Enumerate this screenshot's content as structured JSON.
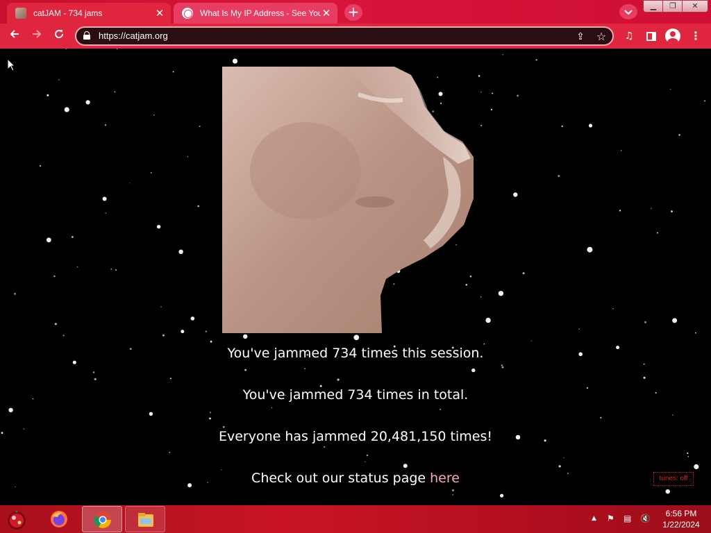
{
  "browser": {
    "tabs": [
      {
        "title": "catJAM - 734 jams",
        "active": true,
        "favicon": "cat-favicon-icon"
      },
      {
        "title": "What Is My IP Address - See Your",
        "active": false,
        "favicon": "globe-icon"
      }
    ],
    "new_tab_symbol": "+",
    "address": {
      "url": "https://catjam.org"
    },
    "theme_color": "#e0263f"
  },
  "page": {
    "session_message": "You've jammed 734 times this session.",
    "total_message": "You've jammed 734 times in total.",
    "global_message": "Everyone has jammed 20,481,150 times!",
    "status_prefix": "Check out our status page ",
    "status_link": "here",
    "tunes_toggle": "tunes: off"
  },
  "taskbar": {
    "pinned": [
      {
        "name": "firefox-icon"
      },
      {
        "name": "chrome-icon",
        "active": true
      },
      {
        "name": "file-explorer-icon"
      }
    ],
    "clock": {
      "time": "6:56 PM",
      "date": "1/22/2024"
    }
  }
}
